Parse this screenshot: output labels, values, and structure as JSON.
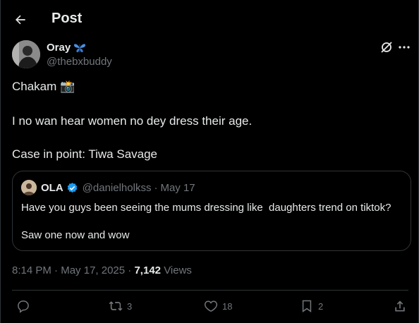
{
  "header": {
    "title": "Post"
  },
  "author": {
    "name": "Oray",
    "badge_emoji": "🦋",
    "handle": "@thebxbuddy"
  },
  "post": {
    "line1": "Chakam 📸",
    "line2": "I no wan hear women no dey dress their age.",
    "line3": "Case in point: Tiwa Savage"
  },
  "quote": {
    "name": "OLA",
    "handle": "@danielholkss",
    "separator": "·",
    "date": "May 17",
    "line1": "Have you guys been seeing the mums dressing like  daughters trend on tiktok?",
    "line2": "Saw one now and wow"
  },
  "meta": {
    "time": "8:14 PM",
    "separator": "·",
    "date": "May 17, 2025",
    "views_count": "7,142",
    "views_label": "Views"
  },
  "actions": {
    "replies": "",
    "reposts": "3",
    "likes": "18",
    "bookmarks": "2"
  },
  "colors": {
    "background": "#000000",
    "text": "#e7e9ea",
    "muted": "#71767b",
    "border": "#2f3336",
    "verified": "#1d9bf0"
  }
}
